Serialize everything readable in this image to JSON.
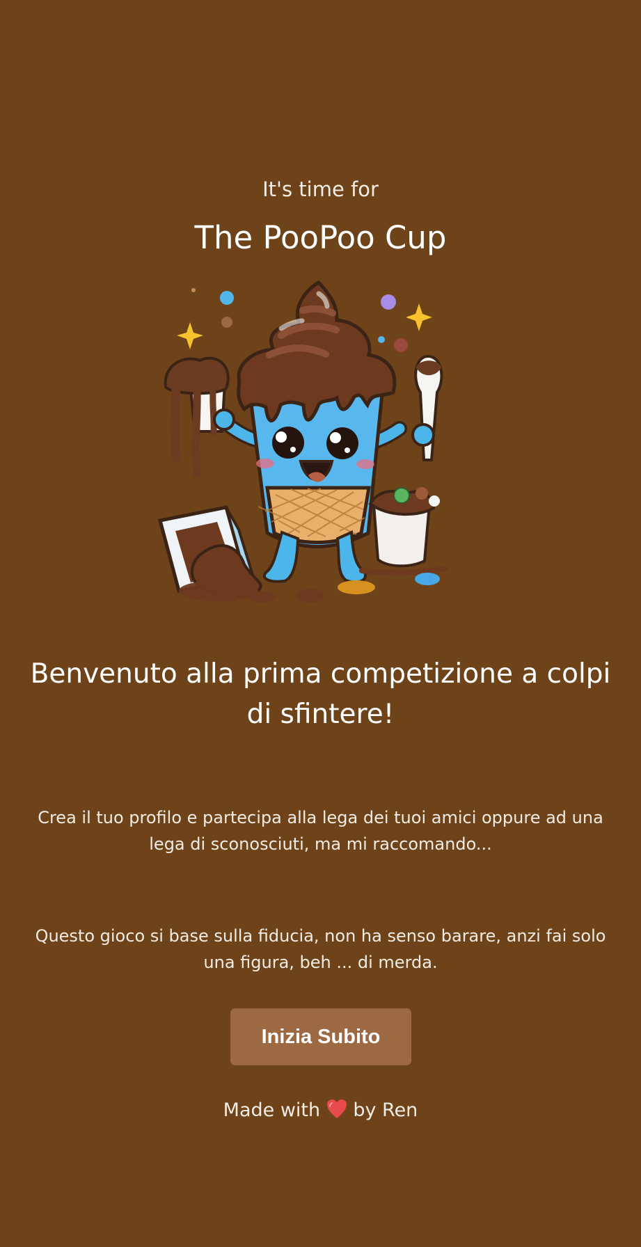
{
  "intro": {
    "kicker": "It's time for",
    "title": "The PooPoo Cup"
  },
  "hero": {
    "icon": "poop-ice-cream-cup-mascot"
  },
  "welcome": {
    "headline": "Benvenuto alla prima competizione a colpi di sfintere!",
    "paragraph_1": "Crea il tuo profilo e partecipa alla lega dei tuoi amici oppure ad una lega di sconosciuti, ma mi raccomando...",
    "paragraph_2": "Questo gioco si base sulla fiducia, non ha senso barare, anzi fai solo una figura, beh ... di merda."
  },
  "cta": {
    "label": "Inizia Subito"
  },
  "footer": {
    "prefix": "Made with",
    "heart_icon": "heart-icon",
    "suffix": "by Ren"
  },
  "colors": {
    "background": "#6e4319",
    "button": "#9c6943",
    "text": "#ffffff"
  }
}
